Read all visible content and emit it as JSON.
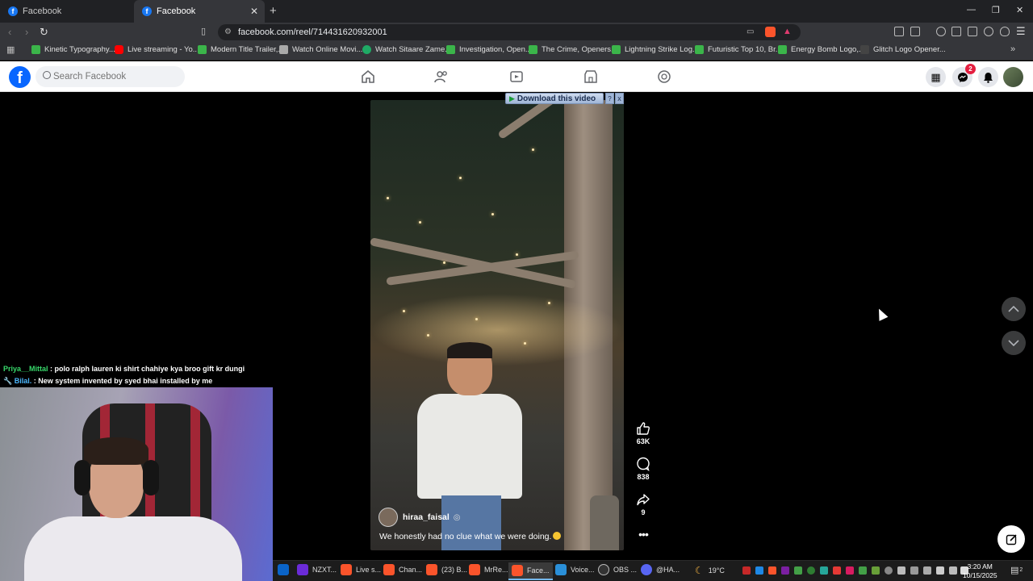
{
  "browser": {
    "tabs": [
      {
        "label": "Facebook",
        "active": false
      },
      {
        "label": "Facebook",
        "active": true
      }
    ],
    "url": "facebook.com/reel/714431620932001",
    "bookmarks": [
      {
        "label": "Kinetic Typography...",
        "icon": "green"
      },
      {
        "label": "Live streaming - Yo...",
        "icon": "youtube"
      },
      {
        "label": "Modern Title Trailer,...",
        "icon": "green"
      },
      {
        "label": "Watch Online Movi...",
        "icon": "tv"
      },
      {
        "label": "Watch Sitaare Zame...",
        "icon": "circle"
      },
      {
        "label": "Investigation, Open...",
        "icon": "green"
      },
      {
        "label": "The Crime, Openers...",
        "icon": "green"
      },
      {
        "label": "Lightning Strike Log...",
        "icon": "green"
      },
      {
        "label": "Futuristic Top 10, Br...",
        "icon": "green"
      },
      {
        "label": "Energy Bomb Logo,...",
        "icon": "green"
      },
      {
        "label": "Glitch Logo Opener...",
        "icon": "dark"
      }
    ]
  },
  "facebook": {
    "search_placeholder": "Search Facebook",
    "messenger_badge": "2",
    "brand_color": "#0866ff"
  },
  "reel": {
    "creator": "hiraa_faisal",
    "caption": "We honestly had no clue what we were doing.",
    "likes": "63K",
    "comments": "838",
    "shares": "9",
    "download_label": "Download this video",
    "download_help": "?",
    "download_close": "x"
  },
  "stream": {
    "chat": [
      {
        "user": "Priya__Mittal",
        "message": " : polo ralph lauren ki shirt chahiye kya broo gift kr dungi"
      },
      {
        "user": "Bilal.",
        "message": " : New system invented by syed bhai installed by me"
      }
    ]
  },
  "taskbar": {
    "items": [
      {
        "label": "NZXT..."
      },
      {
        "label": "Live s..."
      },
      {
        "label": "Chan..."
      },
      {
        "label": "(23) B..."
      },
      {
        "label": "MrRe..."
      },
      {
        "label": "Face...",
        "active": true
      },
      {
        "label": "Voice..."
      },
      {
        "label": "OBS ..."
      },
      {
        "label": "@HA..."
      }
    ],
    "weather": "19°C",
    "time": "3:20 AM",
    "date": "10/15/2025",
    "notifications": "2"
  }
}
